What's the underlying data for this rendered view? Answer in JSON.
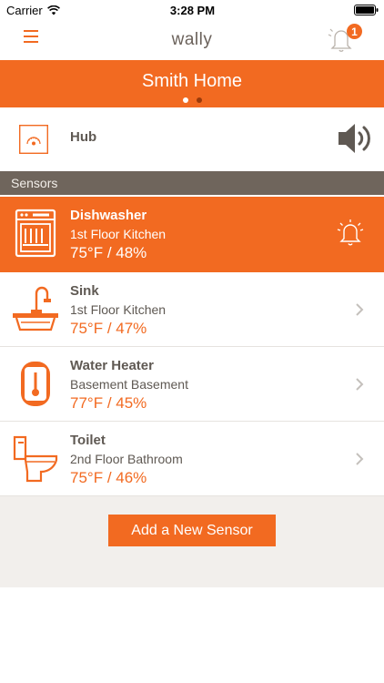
{
  "status_bar": {
    "carrier": "Carrier",
    "time": "3:28 PM"
  },
  "nav": {
    "brand": "wally",
    "notification_count": "1"
  },
  "home": {
    "title": "Smith Home",
    "page_count": 2,
    "active_page": 1
  },
  "hub": {
    "label": "Hub"
  },
  "sensors_section": {
    "title": "Sensors"
  },
  "sensors": [
    {
      "name": "Dishwasher",
      "location": "1st Floor Kitchen",
      "reading": "75°F / 48%",
      "icon": "dishwasher-icon",
      "alert": true
    },
    {
      "name": "Sink",
      "location": "1st Floor Kitchen",
      "reading": "75°F / 47%",
      "icon": "sink-icon",
      "alert": false
    },
    {
      "name": "Water Heater",
      "location": "Basement Basement",
      "reading": "77°F / 45%",
      "icon": "water-heater-icon",
      "alert": false
    },
    {
      "name": "Toilet",
      "location": "2nd Floor Bathroom",
      "reading": "75°F / 46%",
      "icon": "toilet-icon",
      "alert": false
    }
  ],
  "actions": {
    "add_sensor": "Add a New Sensor"
  },
  "colors": {
    "accent": "#f26a21",
    "section_header": "#6f655c",
    "text": "#5f5953"
  }
}
